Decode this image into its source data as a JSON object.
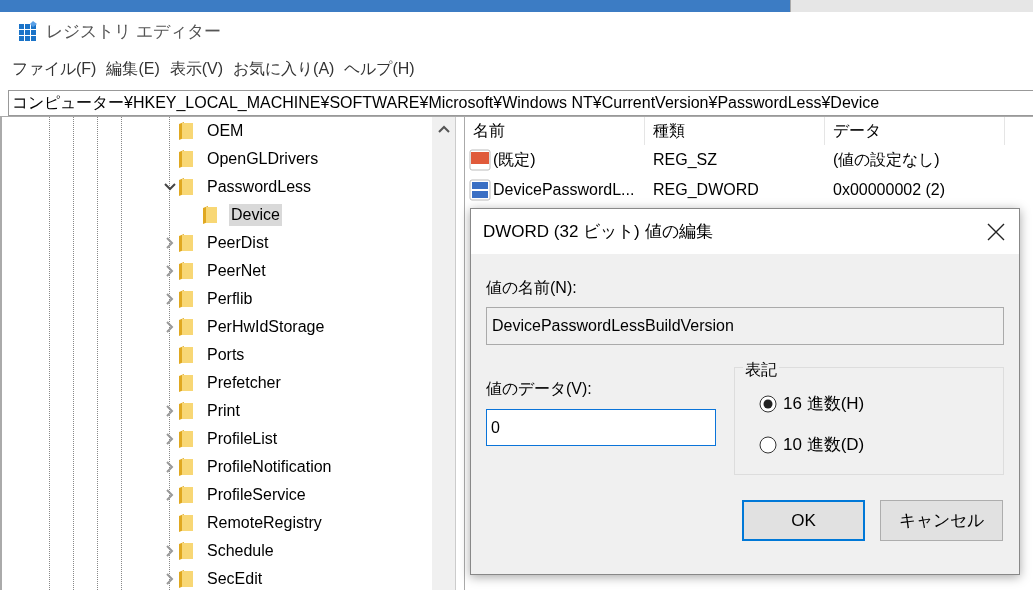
{
  "window": {
    "title": "レジストリ エディター"
  },
  "menu": [
    "ファイル(F)",
    "編集(E)",
    "表示(V)",
    "お気に入り(A)",
    "ヘルプ(H)"
  ],
  "address": "コンピューター¥HKEY_LOCAL_MACHINE¥SOFTWARE¥Microsoft¥Windows NT¥CurrentVersion¥PasswordLess¥Device",
  "tree": [
    {
      "label": "OEM",
      "selected": false
    },
    {
      "label": "OpenGLDrivers",
      "selected": false
    },
    {
      "label": "PasswordLess",
      "expanded": true,
      "selected": false,
      "children": [
        {
          "label": "Device",
          "selected": true
        }
      ]
    },
    {
      "label": "PeerDist",
      "expanded": false,
      "selected": false
    },
    {
      "label": "PeerNet",
      "expanded": false,
      "selected": false
    },
    {
      "label": "Perflib",
      "expanded": false,
      "selected": false
    },
    {
      "label": "PerHwIdStorage",
      "expanded": false,
      "selected": false
    },
    {
      "label": "Ports",
      "selected": false
    },
    {
      "label": "Prefetcher",
      "selected": false
    },
    {
      "label": "Print",
      "expanded": false,
      "selected": false
    },
    {
      "label": "ProfileList",
      "expanded": false,
      "selected": false
    },
    {
      "label": "ProfileNotification",
      "expanded": false,
      "selected": false
    },
    {
      "label": "ProfileService",
      "expanded": false,
      "selected": false
    },
    {
      "label": "RemoteRegistry",
      "selected": false
    },
    {
      "label": "Schedule",
      "expanded": false,
      "selected": false
    },
    {
      "label": "SecEdit",
      "expanded": false,
      "selected": false
    }
  ],
  "values": {
    "columns": [
      "名前",
      "種類",
      "データ"
    ],
    "rows": [
      {
        "kind": "string",
        "name": "(既定)",
        "type": "REG_SZ",
        "data": "(値の設定なし)"
      },
      {
        "kind": "binary",
        "name": "DevicePasswordL...",
        "type": "REG_DWORD",
        "data": "0x00000002 (2)"
      }
    ]
  },
  "dialog": {
    "title": "DWORD (32 ビット) 値の編集",
    "name_label": "値の名前(N):",
    "name_value": "DevicePasswordLessBuildVersion",
    "data_label": "値のデータ(V):",
    "data_value": "0",
    "base_group": "表記",
    "bases": [
      {
        "label": "16 進数(H)",
        "selected": true
      },
      {
        "label": "10 進数(D)",
        "selected": false
      }
    ],
    "buttons": [
      {
        "label": "OK",
        "default": true
      },
      {
        "label": "キャンセル",
        "default": false
      }
    ]
  }
}
